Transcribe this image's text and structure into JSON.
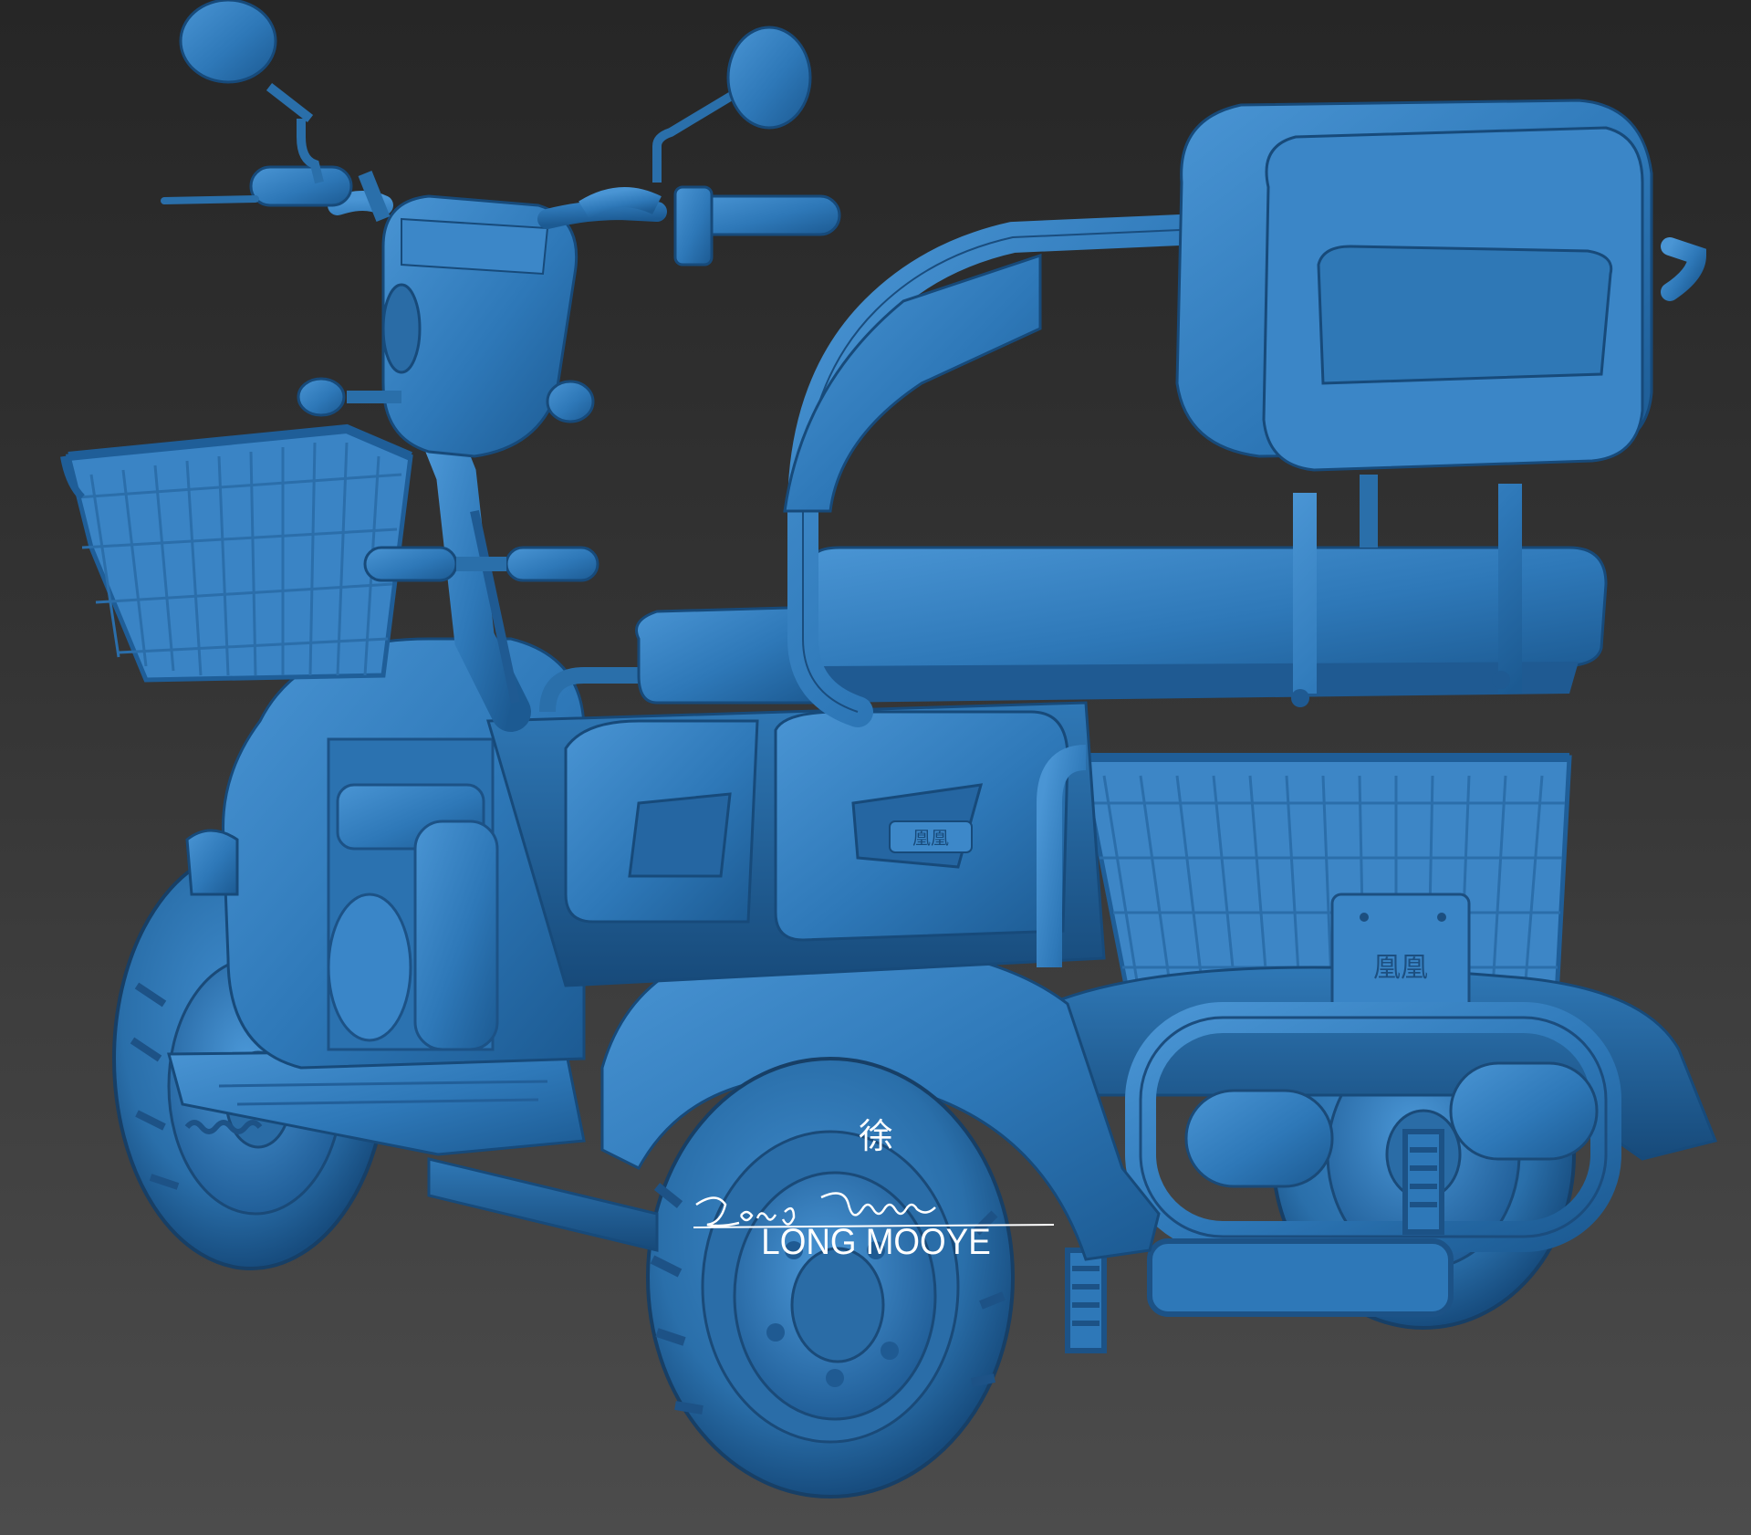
{
  "scene": {
    "subject": "3D clay render of an electric mobility tricycle",
    "model_color": "#2e78b8",
    "background_top": "#262626",
    "background_bottom": "#4c4c4c"
  },
  "plates": {
    "side_badge": "凰凰",
    "rear_plate": "凰凰"
  },
  "watermark": {
    "mark": "徐",
    "signature": "Long Mooye",
    "name": "LONG MOOYE"
  }
}
